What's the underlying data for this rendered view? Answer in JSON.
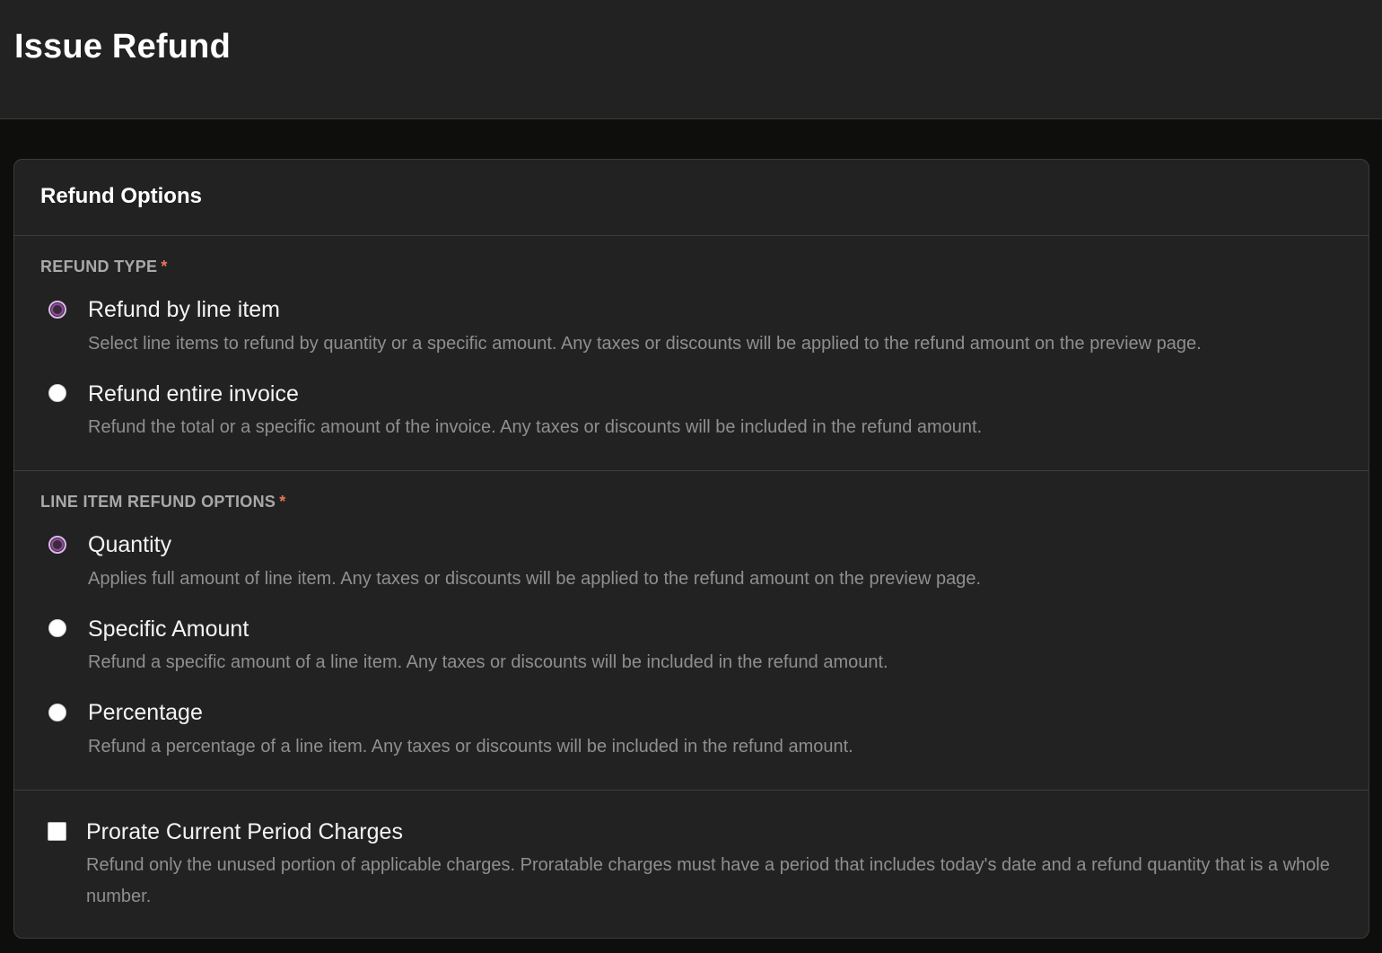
{
  "header": {
    "title": "Issue Refund"
  },
  "card": {
    "title": "Refund Options",
    "refund_type": {
      "label": "REFUND TYPE",
      "required_mark": "*",
      "options": [
        {
          "label": "Refund by line item",
          "description": "Select line items to refund by quantity or a specific amount. Any taxes or discounts will be applied to the refund amount on the preview page.",
          "selected": true
        },
        {
          "label": "Refund entire invoice",
          "description": "Refund the total or a specific amount of the invoice. Any taxes or discounts will be included in the refund amount.",
          "selected": false
        }
      ]
    },
    "line_item_options": {
      "label": "LINE ITEM REFUND OPTIONS",
      "required_mark": "*",
      "options": [
        {
          "label": "Quantity",
          "description": "Applies full amount of line item. Any taxes or discounts will be applied to the refund amount on the preview page.",
          "selected": true
        },
        {
          "label": "Specific Amount",
          "description": "Refund a specific amount of a line item. Any taxes or discounts will be included in the refund amount.",
          "selected": false
        },
        {
          "label": "Percentage",
          "description": "Refund a percentage of a line item. Any taxes or discounts will be included in the refund amount.",
          "selected": false
        }
      ]
    },
    "prorate": {
      "label": "Prorate Current Period Charges",
      "description": "Refund only the unused portion of applicable charges. Proratable charges must have a period that includes today's date and a refund quantity that is a whole number.",
      "checked": false
    }
  },
  "colors": {
    "background": "#0e0e0d",
    "panel": "#222222",
    "required": "#e7745a",
    "radio_selected": "#8f4c9b"
  }
}
